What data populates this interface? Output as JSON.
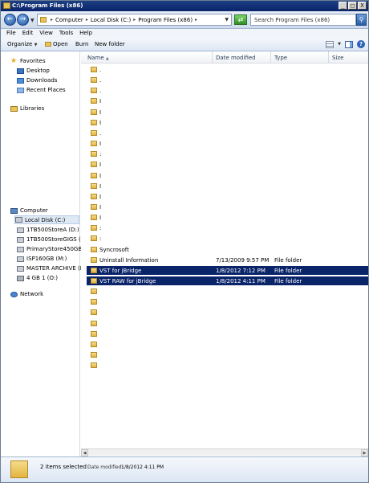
{
  "window": {
    "title": "C:\\Program Files (x86)",
    "controls": {
      "minimize": "_",
      "maximize": "□",
      "close": "X"
    }
  },
  "addressbar": {
    "back_icon": "back-arrow-icon",
    "forward_icon": "forward-arrow-icon",
    "breadcrumbs": [
      "Computer",
      "Local Disk (C:)",
      "Program Files (x86)"
    ],
    "search_placeholder": "Search Program Files (x86)"
  },
  "menubar": [
    "File",
    "Edit",
    "View",
    "Tools",
    "Help"
  ],
  "commandbar": {
    "organize": "Organize",
    "open": "Open",
    "burn": "Burn",
    "new_folder": "New folder"
  },
  "navpane": {
    "favorites": "Favorites",
    "desktop": "Desktop",
    "downloads": "Downloads",
    "recent_places": "Recent Places",
    "libraries": "Libraries",
    "computer": "Computer",
    "drives": [
      "Local Disk (C:)",
      "1TB500StoreA (D:)",
      "1TB500StoreGIGS (E:)",
      "PrimaryStore450GB (F",
      "ISP160GB (M:)",
      "MASTER ARCHIVE (N:",
      "4 GB 1 (O:)"
    ],
    "network": "Network"
  },
  "columns": {
    "name": "Name",
    "date_modified": "Date modified",
    "type": "Type",
    "size": "Size"
  },
  "files": [
    {
      "name": ".",
      "date": "",
      "type": ""
    },
    {
      "name": ".",
      "date": "",
      "type": ""
    },
    {
      "name": ".",
      "date": "",
      "type": ""
    },
    {
      "name": "I",
      "date": "",
      "type": ""
    },
    {
      "name": "I",
      "date": "",
      "type": ""
    },
    {
      "name": "I",
      "date": "",
      "type": ""
    },
    {
      "name": ".",
      "date": "",
      "type": ""
    },
    {
      "name": "I",
      "date": "",
      "type": ""
    },
    {
      "name": ":",
      "date": "",
      "type": ""
    },
    {
      "name": "I",
      "date": "",
      "type": ""
    },
    {
      "name": "I",
      "date": "",
      "type": ""
    },
    {
      "name": "I",
      "date": "",
      "type": ""
    },
    {
      "name": "I",
      "date": "",
      "type": ""
    },
    {
      "name": "I",
      "date": "",
      "type": ""
    },
    {
      "name": "I",
      "date": "",
      "type": ""
    },
    {
      "name": ":",
      "date": "",
      "type": ""
    },
    {
      "name": ":",
      "date": "",
      "type": ""
    },
    {
      "name": "Syncrosoft",
      "date": "",
      "type": ""
    },
    {
      "name": "Uninstall Information",
      "date": "7/13/2009 9:57 PM",
      "type": "File folder"
    },
    {
      "name": "VST for jBridge",
      "date": "1/8/2012 7:12 PM",
      "type": "File folder"
    },
    {
      "name": "VST RAW for jBridge",
      "date": "1/8/2012 4:11 PM",
      "type": "File folder"
    },
    {
      "name": "",
      "date": "",
      "type": ""
    },
    {
      "name": "",
      "date": "",
      "type": ""
    },
    {
      "name": "",
      "date": "",
      "type": ""
    },
    {
      "name": "",
      "date": "",
      "type": ""
    },
    {
      "name": "",
      "date": "",
      "type": ""
    },
    {
      "name": "",
      "date": "",
      "type": ""
    },
    {
      "name": "",
      "date": "",
      "type": ""
    },
    {
      "name": "",
      "date": "",
      "type": ""
    }
  ],
  "selected": [
    "VST for jBridge",
    "VST RAW for jBridge"
  ],
  "details": {
    "count": "2 items selected",
    "date_label": "Date modified:",
    "date_value": "1/8/2012 4:11 PM"
  },
  "colors": {
    "selection": "#0a246a",
    "titlebar": "#0a246a",
    "folder": "#e2b441"
  }
}
